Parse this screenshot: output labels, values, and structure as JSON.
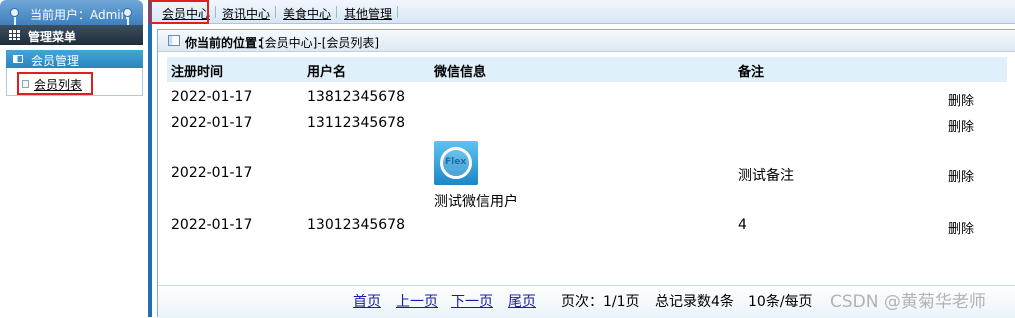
{
  "sidebar": {
    "user_label": "当前用户：Admin",
    "menu_title": "管理菜单",
    "group_title": "会员管理",
    "items": [
      {
        "label": "会员列表"
      }
    ]
  },
  "topnav": {
    "items": [
      {
        "label": "会员中心"
      },
      {
        "label": "资讯中心"
      },
      {
        "label": "美食中心"
      },
      {
        "label": "其他管理"
      }
    ]
  },
  "breadcrumb": {
    "label": "你当前的位置：",
    "path": "[会员中心]-[会员列表]"
  },
  "table": {
    "headers": [
      "注册时间",
      "用户名",
      "微信信息",
      "备注"
    ],
    "rows": [
      {
        "date": "2022-01-17",
        "username": "13812345678",
        "wechat": "",
        "note": "",
        "action": "删除"
      },
      {
        "date": "2022-01-17",
        "username": "13112345678",
        "wechat": "",
        "note": "",
        "action": "删除"
      },
      {
        "date": "2022-01-17",
        "username": "",
        "wechat": "测试微信用户",
        "wechat_avatar_text": "Flex",
        "note": "测试备注",
        "action": "删除"
      },
      {
        "date": "2022-01-17",
        "username": "13012345678",
        "wechat": "",
        "note": "4",
        "action": "删除"
      }
    ]
  },
  "pager": {
    "first": "首页",
    "prev": "上一页",
    "next": "下一页",
    "last": "尾页",
    "page_info": "页次：1/1页",
    "total_info": "总记录数4条",
    "per_page_info": "10条/每页"
  },
  "watermark": "CSDN @黄菊华老师",
  "colors": {
    "accent": "#1d6fb6",
    "highlight": "#e02020",
    "header_bg": "#dff0fa"
  }
}
